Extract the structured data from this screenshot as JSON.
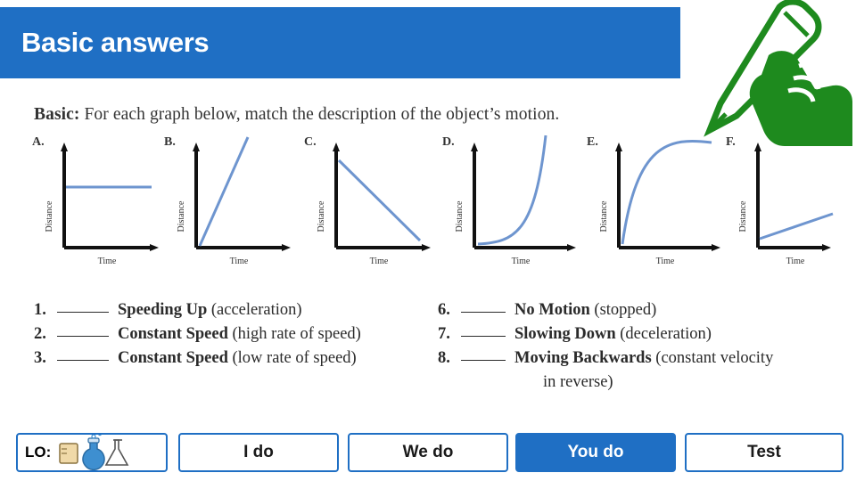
{
  "title": "Basic answers",
  "theme": {
    "accent": "#1F6FC4",
    "graph_line": "#6E95CF",
    "axis": "#1a1a1a",
    "pencil_green": "#1E8A1E"
  },
  "worksheet": {
    "prompt_bold": "Basic:",
    "prompt_rest": " For each graph below, match the description of the object’s motion.",
    "axis_labels": {
      "y": "Distance",
      "x": "Time"
    },
    "graphs": [
      {
        "letter": "A.",
        "shape": "flat"
      },
      {
        "letter": "B.",
        "shape": "steep-linear"
      },
      {
        "letter": "C.",
        "shape": "decreasing-linear"
      },
      {
        "letter": "D.",
        "shape": "exponential-up"
      },
      {
        "letter": "E.",
        "shape": "logarithmic"
      },
      {
        "letter": "F.",
        "shape": "shallow-linear"
      }
    ],
    "answers_left": [
      {
        "num": "1.",
        "label_bold": "Speeding Up",
        "label_rest": " (acceleration)"
      },
      {
        "num": "2.",
        "label_bold": "Constant Speed",
        "label_rest": " (high rate of speed)"
      },
      {
        "num": "3.",
        "label_bold": "Constant Speed",
        "label_rest": " (low rate of speed)"
      }
    ],
    "answers_right": [
      {
        "num": "6.",
        "label_bold": "No Motion",
        "label_rest": " (stopped)",
        "cont": ""
      },
      {
        "num": "7.",
        "label_bold": "Slowing Down",
        "label_rest": " (deceleration)",
        "cont": ""
      },
      {
        "num": "8.",
        "label_bold": "Moving Backwards",
        "label_rest": "  (constant velocity",
        "cont": "in reverse)"
      }
    ]
  },
  "bottom_bar": {
    "lo_label": "LO:",
    "buttons": [
      {
        "label": "I do",
        "filled": false
      },
      {
        "label": "We do",
        "filled": false
      },
      {
        "label": "You do",
        "filled": true
      },
      {
        "label": "Test",
        "filled": false
      }
    ]
  }
}
